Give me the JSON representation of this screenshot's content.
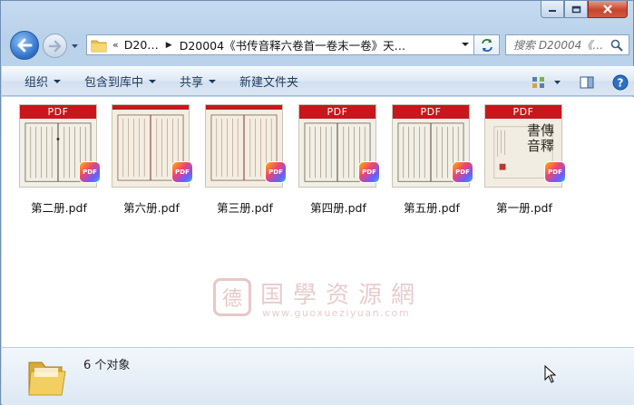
{
  "address": {
    "overflow_label": "«",
    "crumbs": [
      "D20…",
      "D20004《书传音释六卷首一卷末一卷》天…"
    ]
  },
  "search": {
    "placeholder": "搜索 D20004《…"
  },
  "toolbar": {
    "organize": "组织",
    "include_library": "包含到库中",
    "share": "共享",
    "new_folder": "新建文件夹"
  },
  "files": [
    {
      "name": "第二册.pdf",
      "thumb_label": "PDF",
      "badge": "PDF"
    },
    {
      "name": "第六册.pdf",
      "thumb_label": "",
      "badge": "PDF"
    },
    {
      "name": "第三册.pdf",
      "thumb_label": "",
      "badge": "PDF"
    },
    {
      "name": "第四册.pdf",
      "thumb_label": "PDF",
      "badge": "PDF"
    },
    {
      "name": "第五册.pdf",
      "thumb_label": "PDF",
      "badge": "PDF"
    },
    {
      "name": "第一册.pdf",
      "thumb_label": "PDF",
      "badge": "PDF"
    }
  ],
  "cover_title": "書傳音釋",
  "watermark": {
    "seal": "德",
    "text": "国學资源網",
    "url": "www.guoxueziyuan.com"
  },
  "status": {
    "count_text": "6 个对象"
  },
  "colors": {
    "pdf_red": "#c8161d",
    "toolbar_text": "#1e395b",
    "window_frame": "#b9d1ea"
  }
}
